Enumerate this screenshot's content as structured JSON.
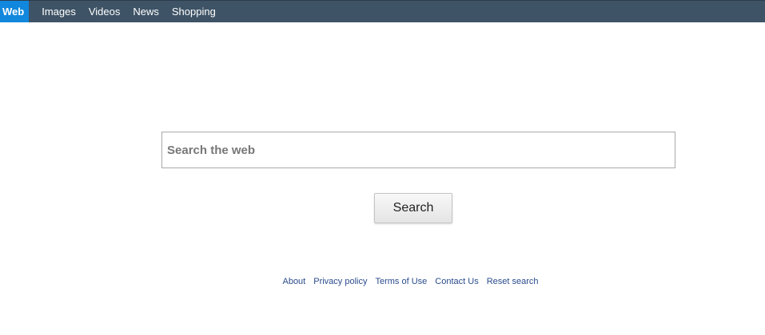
{
  "nav": {
    "tabs": [
      {
        "label": "Web",
        "active": true
      },
      {
        "label": "Images",
        "active": false
      },
      {
        "label": "Videos",
        "active": false
      },
      {
        "label": "News",
        "active": false
      },
      {
        "label": "Shopping",
        "active": false
      }
    ]
  },
  "search": {
    "placeholder": "Search the web",
    "value": "",
    "button_label": "Search"
  },
  "footer": {
    "links": [
      "About",
      "Privacy policy",
      "Terms of Use",
      "Contact Us",
      "Reset search"
    ]
  },
  "colors": {
    "topbar": "#3e5366",
    "active_tab": "#1188dd",
    "link": "#2a4b8d"
  }
}
